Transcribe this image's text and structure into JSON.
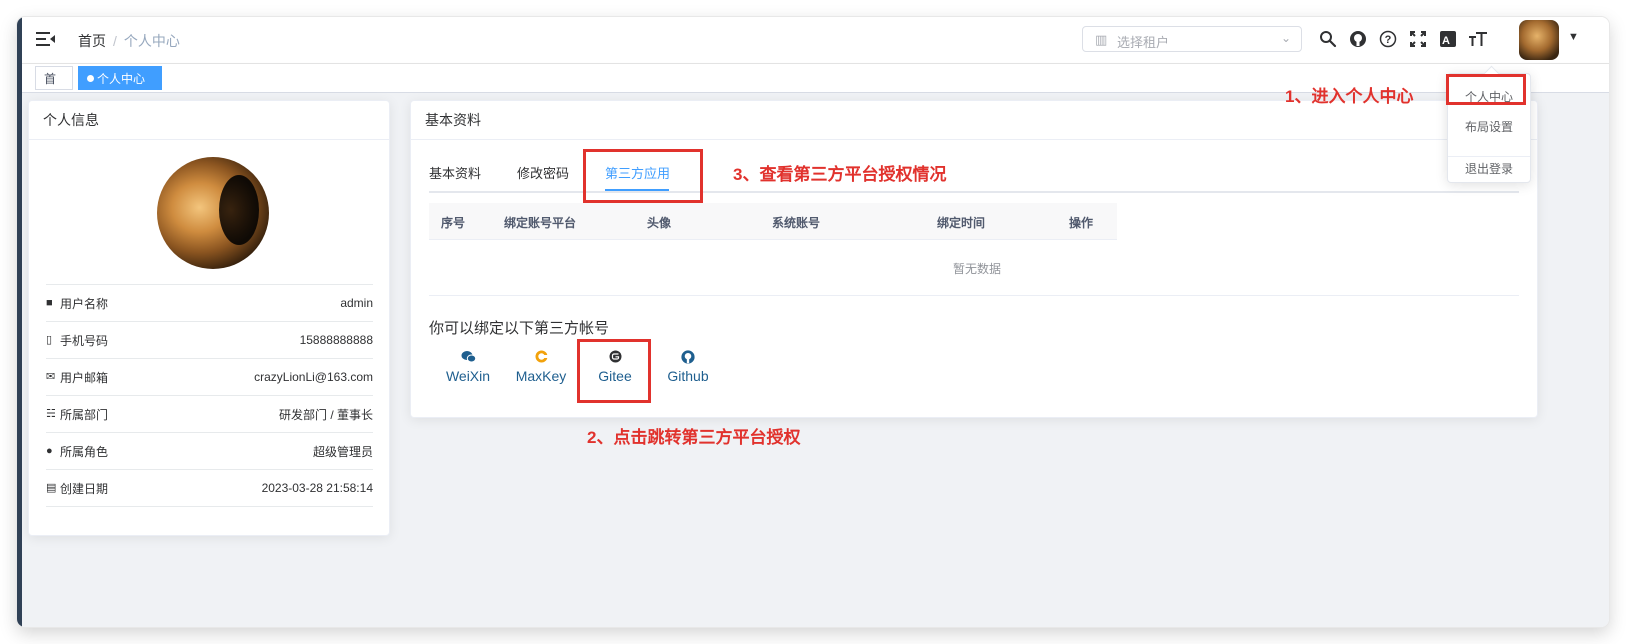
{
  "navbar": {
    "breadcrumb": {
      "home": "首页",
      "separator": "/",
      "current": "个人中心"
    },
    "tenant_select": {
      "placeholder": "选择租户"
    },
    "toolbar_icons": [
      "search-icon",
      "github-icon",
      "help-icon",
      "fullscreen-icon",
      "translate-icon",
      "font-size-icon"
    ]
  },
  "tags": {
    "home": "首页",
    "active": "个人中心",
    "close": "×"
  },
  "profile_card": {
    "title": "个人信息",
    "rows": [
      {
        "icon": "user-icon",
        "label": "用户名称",
        "value": "admin"
      },
      {
        "icon": "phone-icon",
        "label": "手机号码",
        "value": "15888888888"
      },
      {
        "icon": "email-icon",
        "label": "用户邮箱",
        "value": "crazyLionLi@163.com"
      },
      {
        "icon": "tree-icon",
        "label": "所属部门",
        "value": "研发部门 / 董事长"
      },
      {
        "icon": "peoples-icon",
        "label": "所属角色",
        "value": "超级管理员"
      },
      {
        "icon": "date-icon",
        "label": "创建日期",
        "value": "2023-03-28 21:58:14"
      }
    ]
  },
  "basic_card": {
    "title": "基本资料",
    "tabs": [
      "基本资料",
      "修改密码",
      "第三方应用"
    ],
    "active_tab": 2,
    "table": {
      "headers": [
        "序号",
        "绑定账号平台",
        "头像",
        "系统账号",
        "绑定时间",
        "操作"
      ],
      "empty_text": "暂无数据"
    },
    "bind_title": "你可以绑定以下第三方帐号",
    "providers": [
      {
        "name": "WeiXin",
        "icon": "wechat-icon"
      },
      {
        "name": "MaxKey",
        "icon": "maxkey-icon"
      },
      {
        "name": "Gitee",
        "icon": "gitee-icon"
      },
      {
        "name": "Github",
        "icon": "github-icon"
      }
    ]
  },
  "user_menu": {
    "items": [
      "个人中心",
      "布局设置",
      "退出登录"
    ]
  },
  "annotations": {
    "step1": "1、进入个人中心",
    "step2": "2、点击跳转第三方平台授权",
    "step3": "3、查看第三方平台授权情况",
    "color": "#e1322d"
  },
  "colors": {
    "primary": "#409eff",
    "sidebar": "#304156"
  }
}
